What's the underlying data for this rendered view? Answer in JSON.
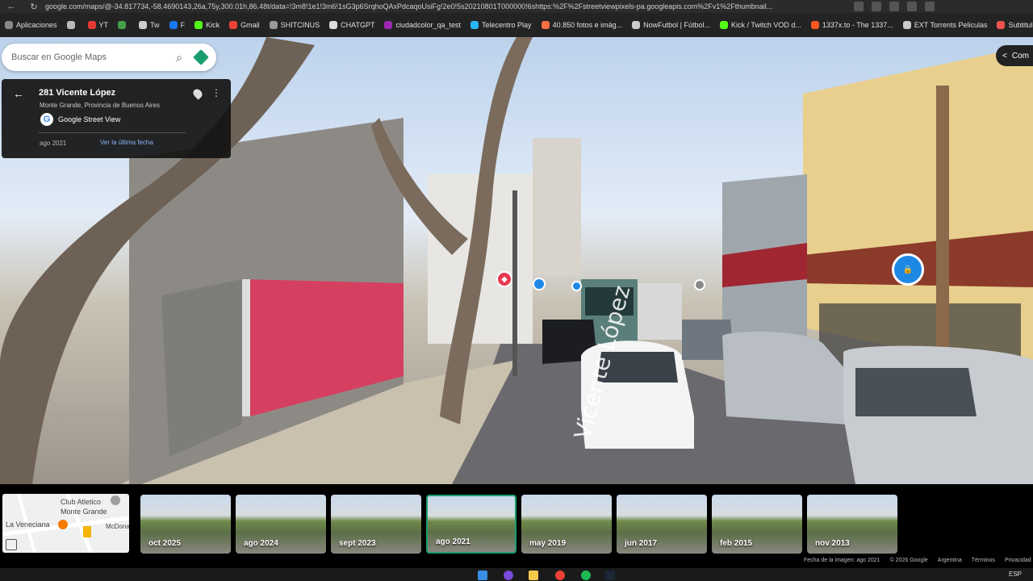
{
  "browser": {
    "url": "google.com/maps/@-34.817734,-58.4690143,26a,75y,300.01h,86.48t/data=!3m8!1e1!3m6!1sG3p6SrqhoQAxPdcaqoUsiFg!2e0!5s20210801T000000!6shttps:%2F%2Fstreetviewpixels-pa.googleapis.com%2Fv1%2Fthumbnail...",
    "bookmarks": [
      {
        "label": "Aplicaciones",
        "color": "#888888"
      },
      {
        "label": "",
        "color": "#bbbbbb"
      },
      {
        "label": "YT",
        "color": "#e53935"
      },
      {
        "label": "",
        "color": "#43a047"
      },
      {
        "label": "Tw",
        "color": "#cccccc"
      },
      {
        "label": "F",
        "color": "#1877f2"
      },
      {
        "label": "Kick",
        "color": "#53fc18"
      },
      {
        "label": "Gmail",
        "color": "#ea4335"
      },
      {
        "label": "SHITCINUS",
        "color": "#999999"
      },
      {
        "label": "CHATGPT",
        "color": "#dddddd"
      },
      {
        "label": "ciudadcolor_qa_test",
        "color": "#9c27b0"
      },
      {
        "label": "Telecentro Play",
        "color": "#29b6f6"
      },
      {
        "label": "40.850 fotos e imág...",
        "color": "#ff7043"
      },
      {
        "label": "NowFutbol | Fútbol...",
        "color": "#cccccc"
      },
      {
        "label": "Kick / Twitch VOD d...",
        "color": "#53fc18"
      },
      {
        "label": "1337x.to - The 1337...",
        "color": "#ff5722"
      },
      {
        "label": "EXT Torrents Peliculas",
        "color": "#cccccc"
      },
      {
        "label": "Subtitulo",
        "color": "#ef5350"
      }
    ]
  },
  "search": {
    "placeholder": "Buscar en Google Maps"
  },
  "info": {
    "address": "281 Vicente López",
    "locality": "Monte Grande, Provincia de Buenos Aires",
    "source": "Google Street View",
    "date": "ago 2021",
    "latest_link": "Ver la última fecha"
  },
  "share": {
    "label": "Com"
  },
  "mini_map": {
    "labels": [
      "Club Atletico",
      "Monte Grande",
      "La Veneciana",
      "McDona"
    ]
  },
  "timeline": [
    {
      "label": "oct 2025"
    },
    {
      "label": "ago 2024"
    },
    {
      "label": "sept 2023"
    },
    {
      "label": "ago 2021",
      "selected": true
    },
    {
      "label": "may 2019"
    },
    {
      "label": "jun 2017"
    },
    {
      "label": "feb 2015"
    },
    {
      "label": "nov 2013"
    }
  ],
  "footer": {
    "image_date": "Fecha de la imagen: ago 2021",
    "copyright": "© 2026 Google",
    "country": "Argentina",
    "terms": "Términos",
    "privacy": "Privacidad"
  },
  "taskbar": {
    "language": "ESP"
  },
  "colors": {
    "accent": "#1a9e6e",
    "link": "#8ab4f8",
    "panel": "#121212"
  }
}
